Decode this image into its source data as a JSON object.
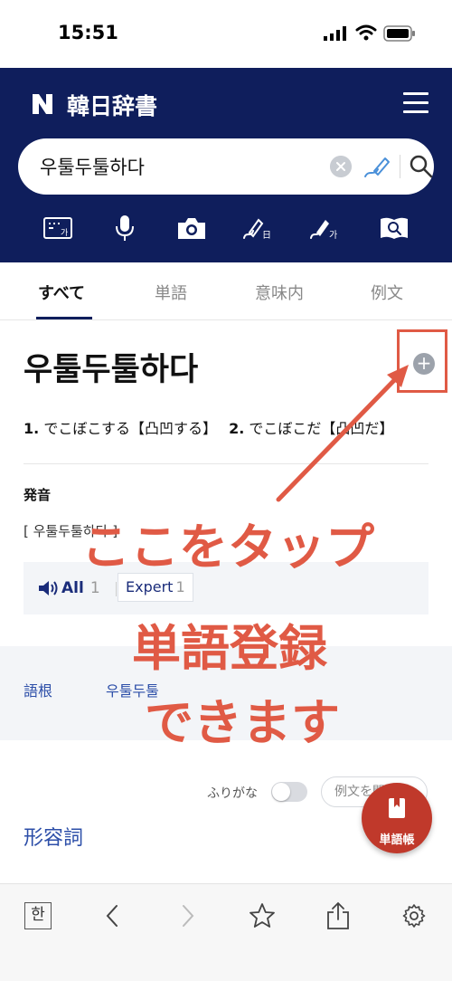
{
  "status_bar": {
    "time": "15:51"
  },
  "header": {
    "title": "韓日辞書"
  },
  "search": {
    "value": "우툴두툴하다"
  },
  "tools": [
    "keyboard-icon",
    "mic-icon",
    "camera-icon",
    "handwriting-japanese-icon",
    "handwriting-korean-icon",
    "book-search-icon"
  ],
  "tabs": [
    {
      "label": "すべて",
      "active": true
    },
    {
      "label": "単語",
      "active": false
    },
    {
      "label": "意味内",
      "active": false
    },
    {
      "label": "例文",
      "active": false
    }
  ],
  "entry": {
    "headword": "우툴두툴하다",
    "meaning1_num": "1.",
    "meaning1": "でこぼこする【凸凹する】",
    "meaning2_num": "2.",
    "meaning2": "でこぼこだ【凸凹だ】",
    "pronunciation_label": "発音",
    "pronunciation": "[ 우툴두툴하다 ]",
    "audio_all_label": "All",
    "audio_all_count": "1",
    "audio_expert_label": "Expert",
    "audio_expert_count": "1",
    "root_label": "語根",
    "root_word": "우툴두툴",
    "furigana_label": "ふりがな",
    "example_open_label": "例文を開く",
    "part_of_speech": "形容詞"
  },
  "vocab_button": {
    "label": "単語帳"
  },
  "annotation": {
    "line1": "ここをタップ",
    "line2": "単語登録",
    "line3": "できます",
    "color": "#e05a45"
  },
  "colors": {
    "navy": "#0f1e5c",
    "accent_red": "#c0392b",
    "link_blue": "#2c4ea8"
  }
}
